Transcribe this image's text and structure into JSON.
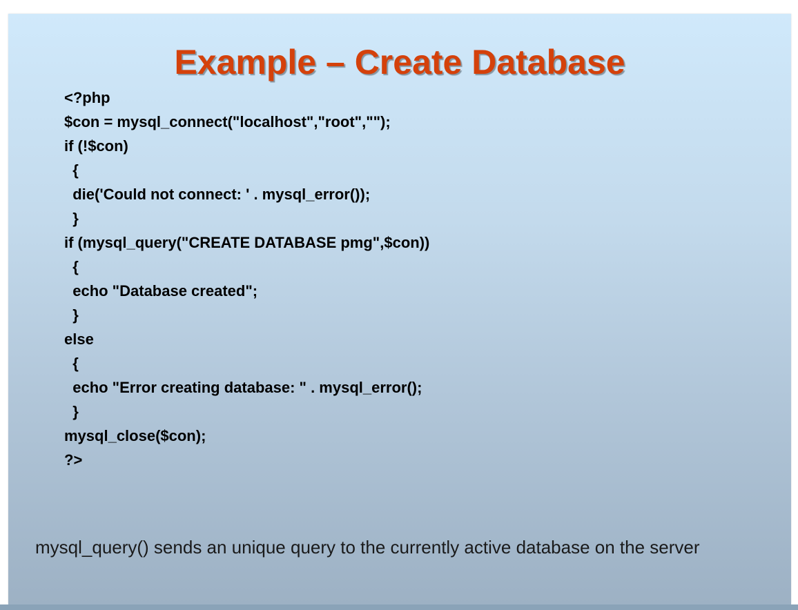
{
  "slide": {
    "title": "Example – Create Database",
    "code_lines": [
      "<?php",
      "$con = mysql_connect(\"localhost\",\"root\",\"\");",
      "if (!$con)",
      "  {",
      "  die('Could not connect: ' . mysql_error());",
      "  }",
      "if (mysql_query(\"CREATE DATABASE pmg\",$con))",
      "  {",
      "  echo \"Database created\";",
      "  }",
      "else",
      "  {",
      "  echo \"Error creating database: \" . mysql_error();",
      "  }",
      "mysql_close($con);",
      "?>"
    ],
    "caption": "mysql_query() sends an unique query to the currently active database on the server"
  },
  "colors": {
    "title": "#d4410b",
    "background_top": "#d0e9fb",
    "background_bottom": "#9db1c4",
    "text": "#000000"
  }
}
